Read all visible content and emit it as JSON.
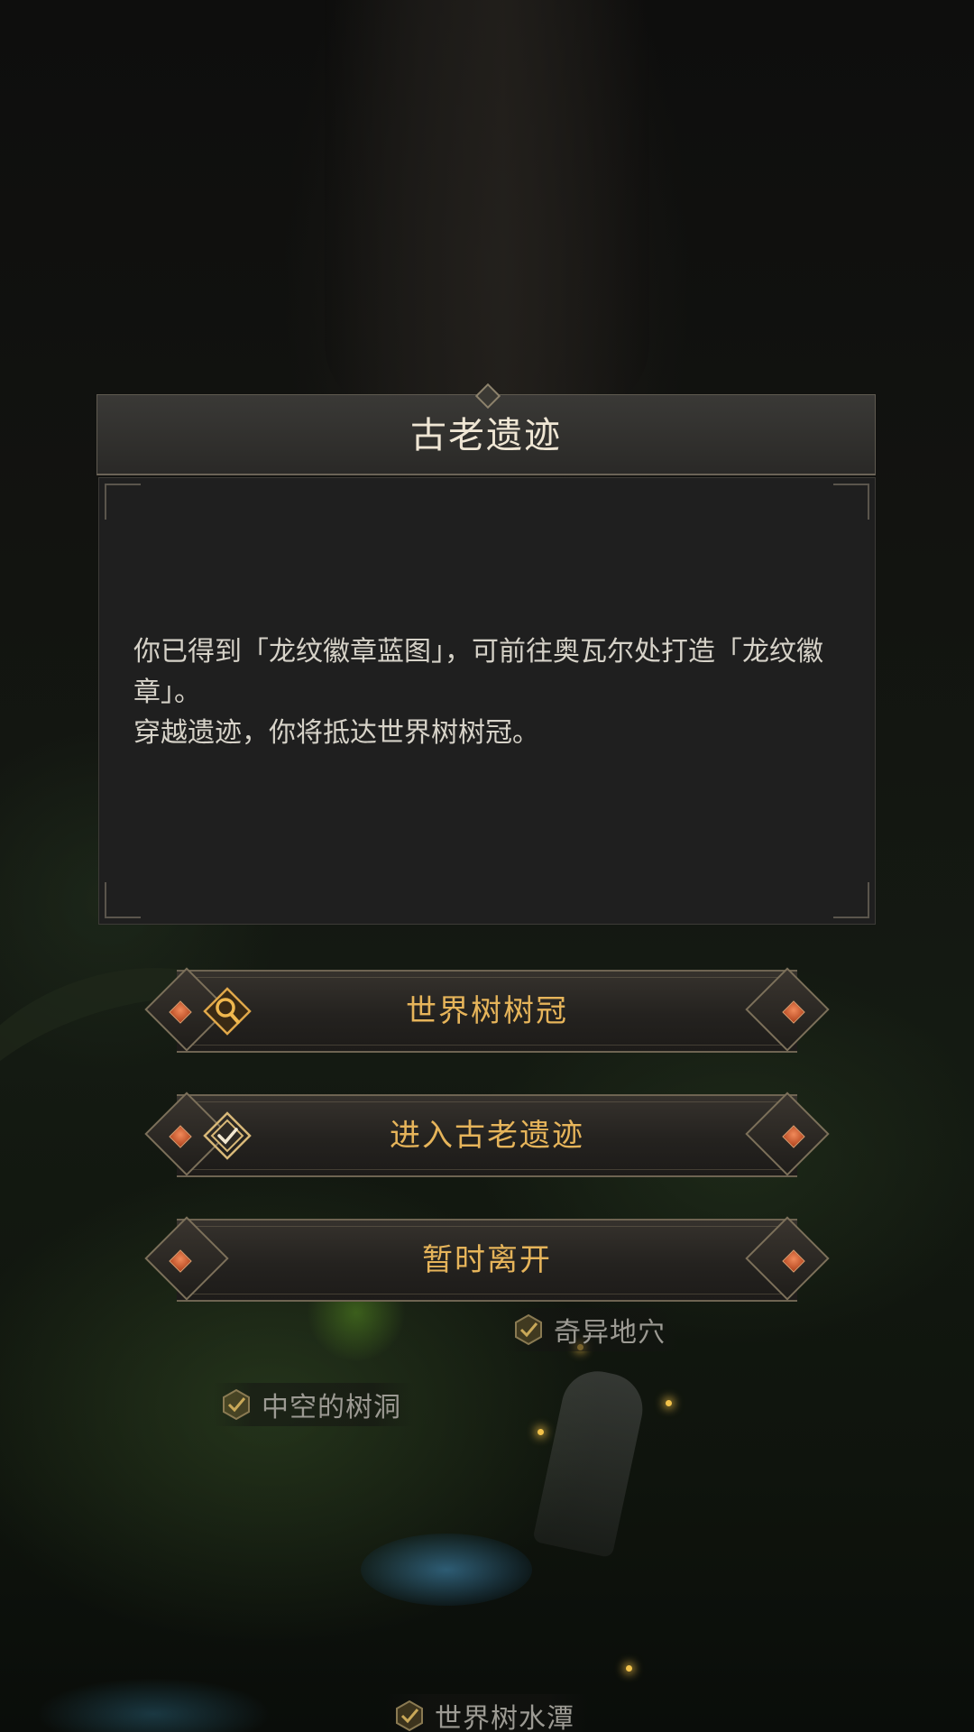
{
  "dialog": {
    "title": "古老遗迹",
    "lines": [
      "你已得到「龙纹徽章蓝图」，可前往奥瓦尔处打造「龙纹徽章」。",
      "穿越遗迹，你将抵达世界树树冠。"
    ]
  },
  "options": [
    {
      "label": "世界树树冠",
      "icon": "magnifier-icon"
    },
    {
      "label": "进入古老遗迹",
      "icon": "check-diamond-icon"
    },
    {
      "label": "暂时离开",
      "icon": ""
    }
  ],
  "map_labels": [
    {
      "label": "奇异地穴",
      "icon": "checkmark-icon"
    },
    {
      "label": "中空的树洞",
      "icon": "checkmark-icon"
    },
    {
      "label": "世界树水潭",
      "icon": "checkmark-icon"
    }
  ],
  "colors": {
    "accent_gold": "#e6b45a",
    "gem_orange": "#d8643a",
    "panel_bg": "#1f1f1f",
    "title_text": "#efe6d4"
  }
}
